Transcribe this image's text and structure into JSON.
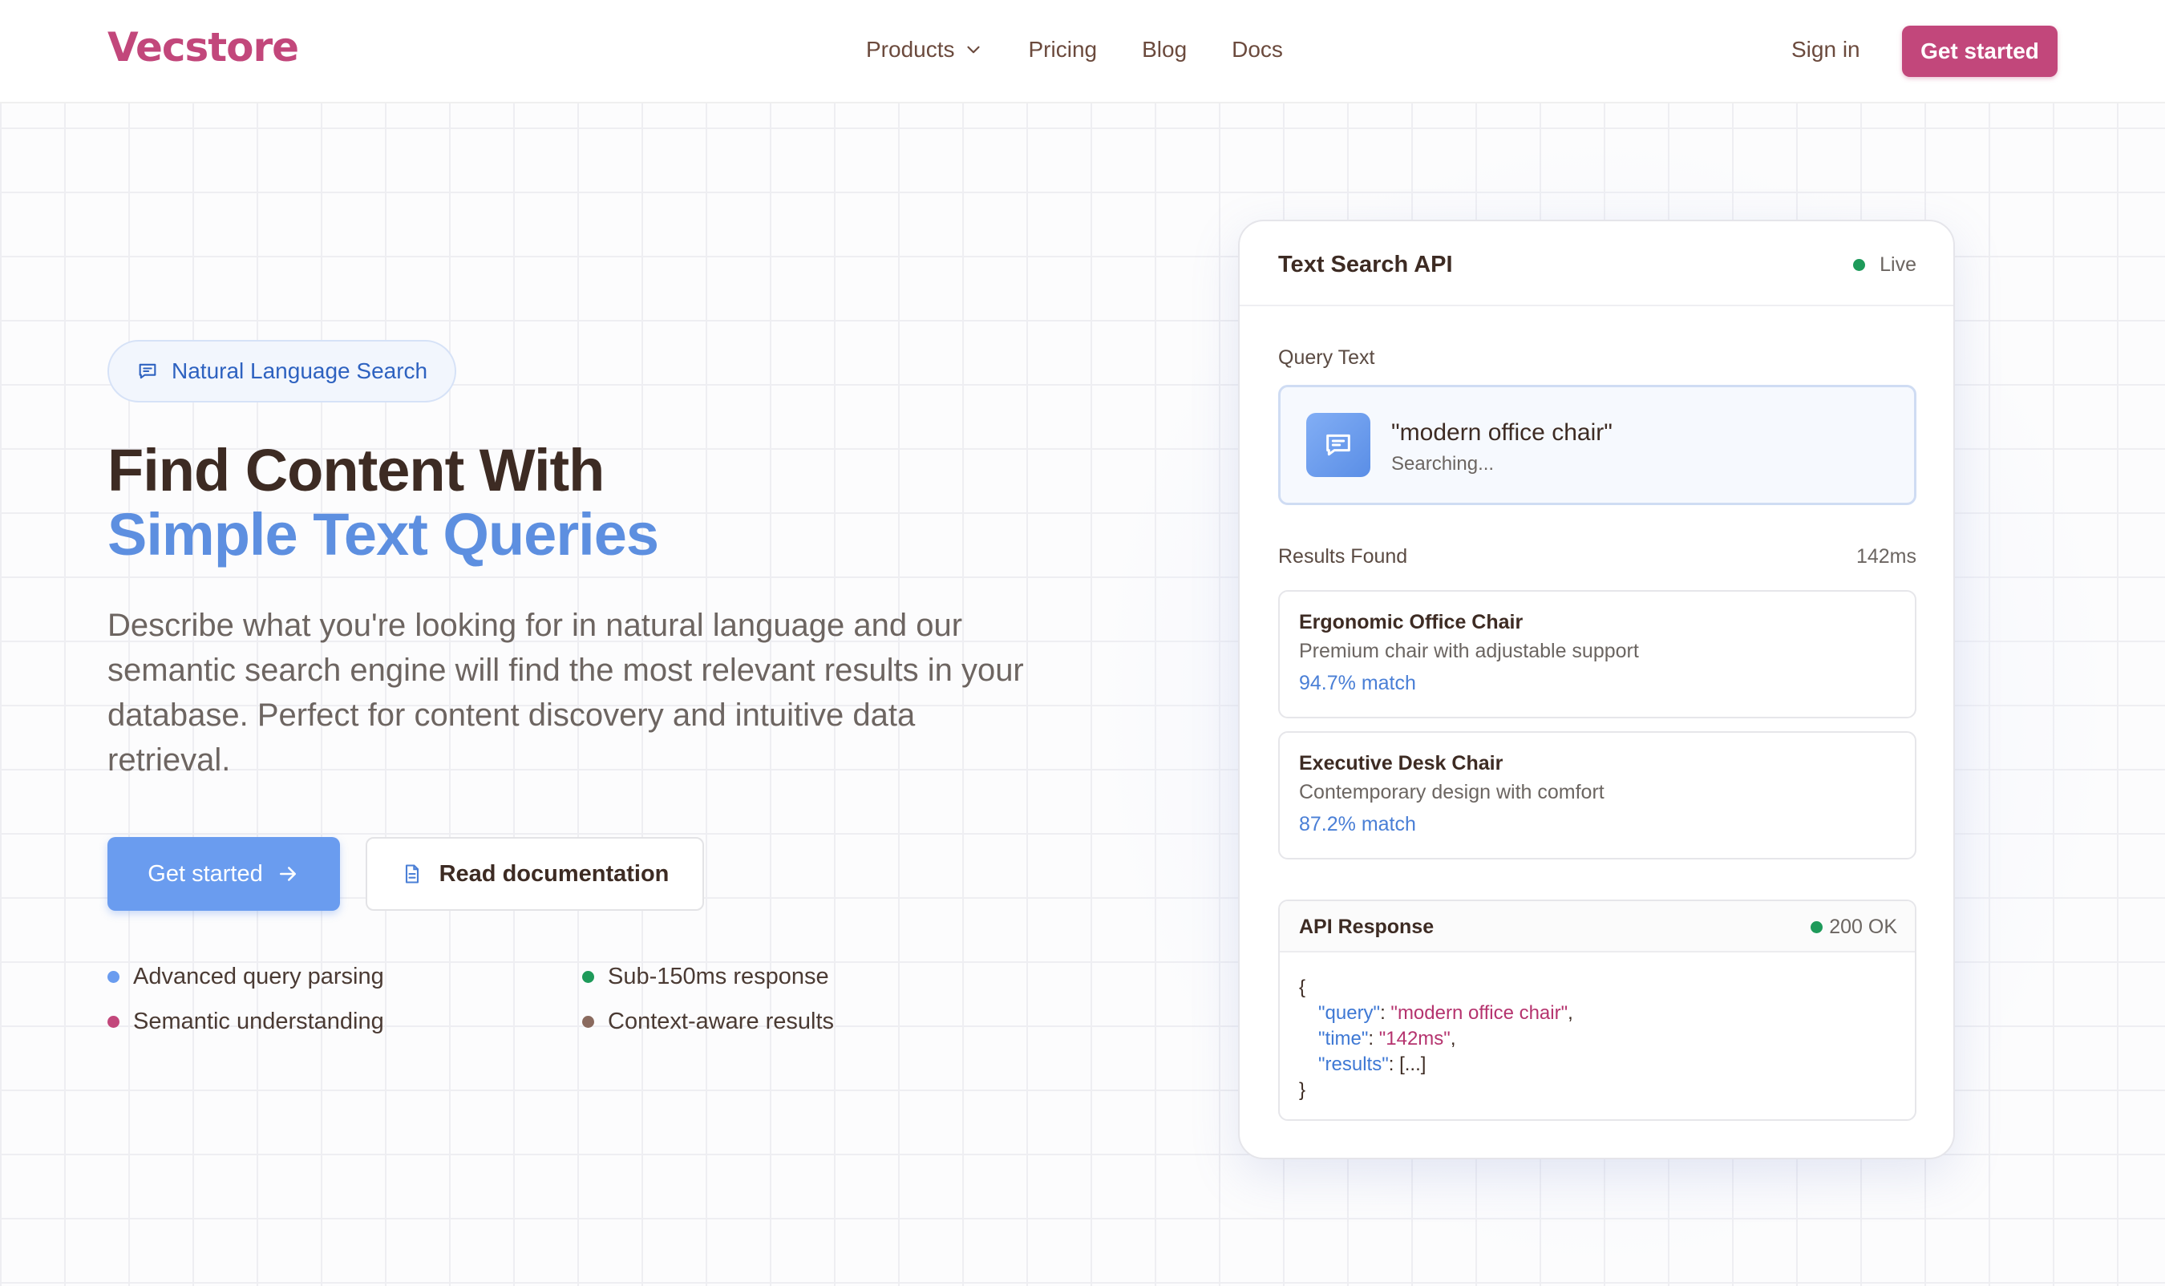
{
  "brand": {
    "name": "Vecstore",
    "color": "#c2477b"
  },
  "nav": {
    "items": [
      "Products",
      "Pricing",
      "Blog",
      "Docs"
    ],
    "sign_in": "Sign in",
    "cta": "Get started"
  },
  "hero": {
    "badge": "Natural Language Search",
    "title_line1": "Find Content With",
    "title_line2": "Simple Text Queries",
    "description": "Describe what you're looking for in natural language and our semantic search engine will find the most relevant results in your database. Perfect for content discovery and intuitive data retrieval.",
    "primary_button": "Get started",
    "secondary_button": "Read documentation",
    "features": [
      {
        "label": "Advanced query parsing",
        "color": "#6a9cef"
      },
      {
        "label": "Sub-150ms response",
        "color": "#1e9a5a"
      },
      {
        "label": "Semantic understanding",
        "color": "#c2477b"
      },
      {
        "label": "Context-aware results",
        "color": "#8a6a5e"
      }
    ]
  },
  "card": {
    "title": "Text Search API",
    "status": "Live",
    "status_color": "#1e9a5a",
    "query_label": "Query Text",
    "query": "\"modern office chair\"",
    "query_status": "Searching...",
    "results_label": "Results Found",
    "latency": "142ms",
    "results": [
      {
        "title": "Ergonomic Office Chair",
        "description": "Premium chair with adjustable support",
        "match": "94.7% match"
      },
      {
        "title": "Executive Desk Chair",
        "description": "Contemporary design with comfort",
        "match": "87.2% match"
      }
    ],
    "api": {
      "title": "API Response",
      "status": "200 OK",
      "open_brace": "{",
      "close_brace": "}",
      "lines": [
        {
          "key": "\"query\"",
          "value": "\"modern office chair\"",
          "value_is_string": true,
          "trail": ","
        },
        {
          "key": "\"time\"",
          "value": "\"142ms\"",
          "value_is_string": true,
          "trail": ","
        },
        {
          "key": "\"results\"",
          "value": "[...]",
          "value_is_string": false,
          "trail": ""
        }
      ]
    }
  }
}
